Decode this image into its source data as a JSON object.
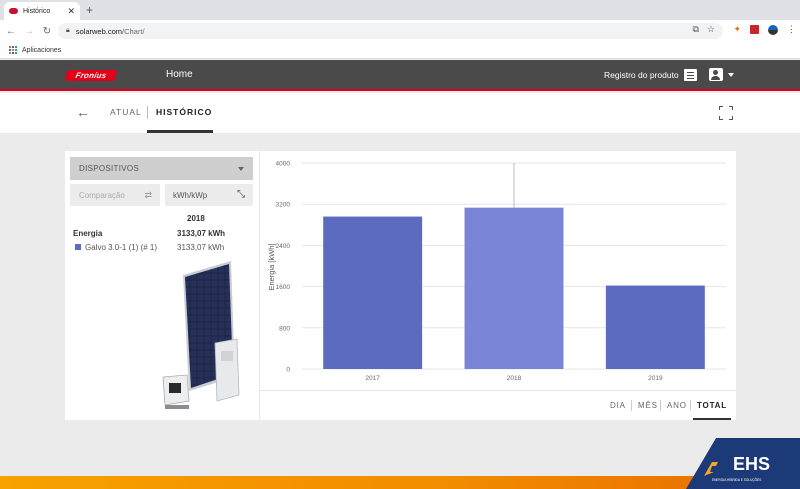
{
  "browser": {
    "tab_title": "Histórico",
    "tab_close": "✕",
    "new_tab": "+",
    "url_host": "solarweb.com",
    "url_path": "/Chart/",
    "bookmark_apps": "Aplicaciones"
  },
  "header": {
    "logo": "Fronius",
    "home": "Home",
    "registro": "Registro do produto"
  },
  "subnav": {
    "tab_atual": "ATUAL",
    "tab_historico": "HISTÓRICO"
  },
  "panel": {
    "dispositivos": "DISPOSITIVOS",
    "comparacao": "Comparação",
    "unit_toggle": "kWh/kWp",
    "year": "2018",
    "energia_label": "Energia",
    "energia_value": "3133,07 kWh",
    "device_name": "Galvo 3.0-1 (1) (# 1)",
    "device_value": "3133,07 kWh",
    "device_color": "#5c6bc0"
  },
  "periods": {
    "dia": "DIA",
    "mes": "MÊS",
    "ano": "ANO",
    "total": "TOTAL",
    "active": "TOTAL"
  },
  "chart_data": {
    "type": "bar",
    "categories": [
      "2017",
      "2018",
      "2019"
    ],
    "values": [
      2960,
      3133.07,
      1620
    ],
    "ylabel": "Energia [kWh]",
    "ylim": [
      0,
      4000
    ],
    "yticks": [
      "0",
      "800",
      "1600",
      "2400",
      "3200",
      "4000"
    ],
    "highlighted": "2018",
    "bar_color": "#5c6bc0",
    "highlight_color": "#7986d8",
    "grid": true
  },
  "brand": {
    "ehs": "EHS",
    "ehs_tagline": "ENERGIA HÍBRIDA E SOLUÇÕES"
  }
}
